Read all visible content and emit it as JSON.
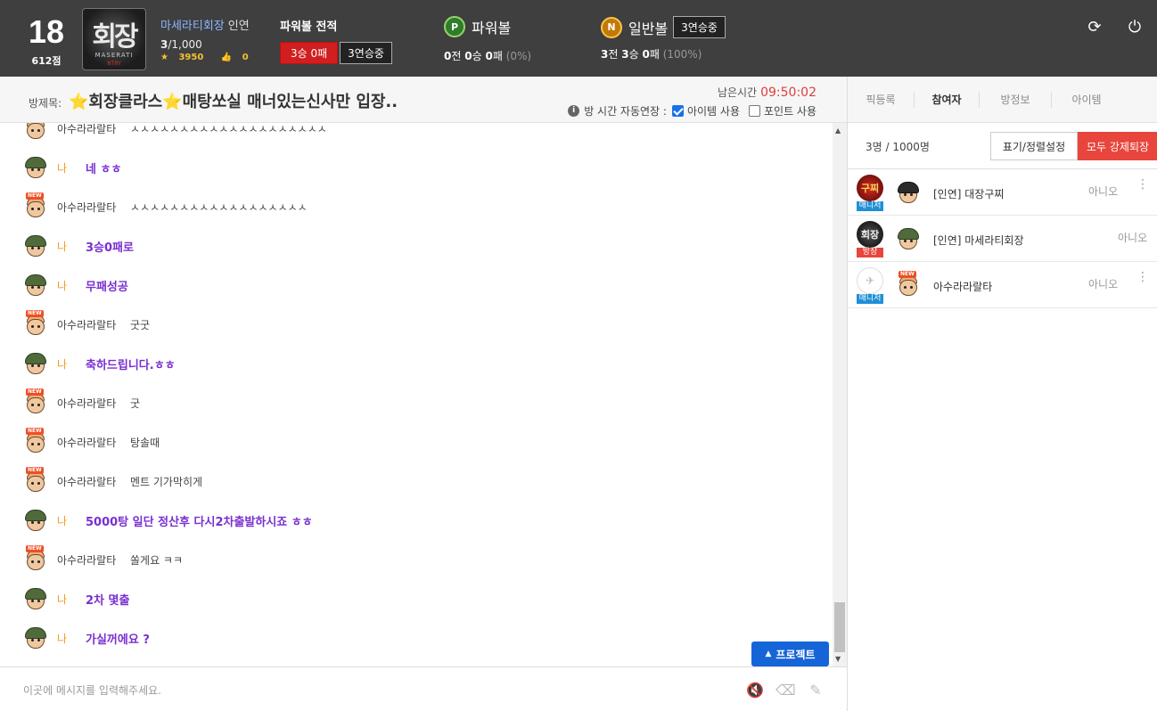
{
  "header": {
    "level": "18",
    "points": "612점",
    "avatar_text": "회장",
    "avatar_sub": "MASERATI",
    "avatar_sub2": "NTRY",
    "username": "마세라티회장",
    "group": "인연",
    "rank_current": "3",
    "rank_total": "/1,000",
    "stars": "3950",
    "likes": "0",
    "record_title": "파워볼 전적",
    "record_badge": "3승 0패",
    "record_streak": "3연승중",
    "powerball": {
      "icon": "P",
      "label": "파워볼",
      "r1": "0",
      "r1s": "전",
      "r2": "0",
      "r2s": "승",
      "r3": "0",
      "r3s": "패",
      "pct": "(0%)"
    },
    "normalball": {
      "icon": "N",
      "label": "일반볼",
      "streak": "3연승중",
      "r1": "3",
      "r1s": "전",
      "r2": "3",
      "r2s": "승",
      "r3": "0",
      "r3s": "패",
      "pct": "(100%)"
    },
    "refresh_icon": "⟳",
    "power_icon": "⏻"
  },
  "room": {
    "label": "방제목:",
    "title": "⭐회장클라스⭐매탕쏘실 매너있는신사만 입장..",
    "remain_label": "남은시간",
    "remain_time": "09:50:02",
    "auto_extend": "방 시간 자동연장 :",
    "item_use": "아이템 사용",
    "point_use": "포인트 사용",
    "info_icon": "i"
  },
  "chat": {
    "messages": [
      {
        "who": "other",
        "nick": "아수라라랄타",
        "text": "ㅅㅅㅅㅅㅅㅅㅅㅅㅅㅅㅅㅅㅅㅅㅅㅅㅅㅅㅅㅅ"
      },
      {
        "who": "me",
        "nick": "나",
        "text": "네 ㅎㅎ"
      },
      {
        "who": "other",
        "nick": "아수라라랄타",
        "text": "ㅅㅅㅅㅅㅅㅅㅅㅅㅅㅅㅅㅅㅅㅅㅅㅅㅅㅅ"
      },
      {
        "who": "me",
        "nick": "나",
        "text": "3승0패로"
      },
      {
        "who": "me",
        "nick": "나",
        "text": "무패성공"
      },
      {
        "who": "other",
        "nick": "아수라라랄타",
        "text": "굿굿"
      },
      {
        "who": "me",
        "nick": "나",
        "text": "축하드립니다.ㅎㅎ"
      },
      {
        "who": "other",
        "nick": "아수라라랄타",
        "text": "굿"
      },
      {
        "who": "other",
        "nick": "아수라라랄타",
        "text": "탕솔때"
      },
      {
        "who": "other",
        "nick": "아수라라랄타",
        "text": "멘트 기가막히게"
      },
      {
        "who": "me",
        "nick": "나",
        "text": "5000탕 일단 정산후 다시2차출발하시죠 ㅎㅎ"
      },
      {
        "who": "other",
        "nick": "아수라라랄타",
        "text": "쏠게요 ㅋㅋ"
      },
      {
        "who": "me",
        "nick": "나",
        "text": "2차 몇출"
      },
      {
        "who": "me",
        "nick": "나",
        "text": "가실꺼에요 ?"
      }
    ],
    "new_tag": "NEW",
    "protect_label": "프로젝트",
    "input_placeholder": "이곳에 메시지를 입력해주세요.",
    "mute_icon": "🔇",
    "eraser_icon": "⌫",
    "magic_icon": "✎",
    "scroll_up": "▲",
    "scroll_down": "▼"
  },
  "panel": {
    "tabs": [
      "픽등록",
      "참여자",
      "방정보",
      "아이템"
    ],
    "active_tab": "참여자",
    "count": "3명 / 1000명",
    "sort_button": "표기/정렬설정",
    "kick_button": "모두 강제퇴장",
    "participants": [
      {
        "avatar": "구찌",
        "role": "매니저",
        "name": "[인연] 대장구찌",
        "state": "아니오",
        "face": "helmet-dark"
      },
      {
        "avatar": "회장",
        "role": "방장",
        "name": "[인연] 마세라티회장",
        "state": "아니오",
        "face": "helmet"
      },
      {
        "avatar": "✈",
        "role": "매니저",
        "name": "아수라라랄타",
        "state": "아니오",
        "face": "new"
      }
    ],
    "more_icon": "⋮"
  }
}
